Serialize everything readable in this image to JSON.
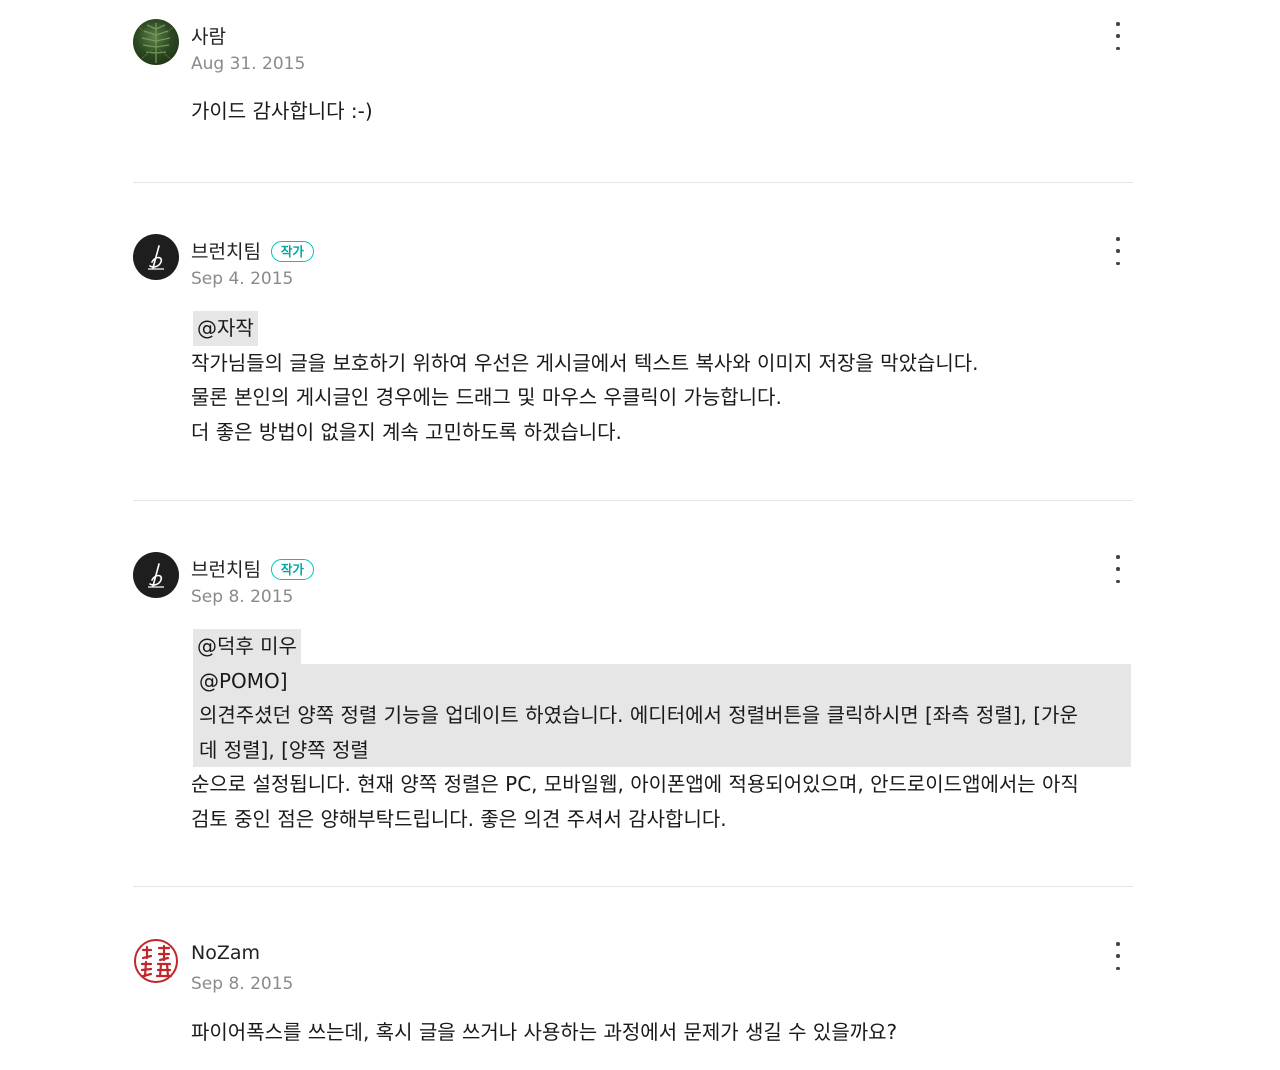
{
  "comments": [
    {
      "author": "사람",
      "date": "Aug 31. 2015",
      "lines": [
        "가이드 감사합니다 :-)"
      ]
    },
    {
      "author": "브런치팀",
      "badge": "작가",
      "date": "Sep 4. 2015",
      "mention": "@자작",
      "lines": [
        "작가님들의 글을 보호하기 위하여 우선은 게시글에서 텍스트 복사와 이미지 저장을 막았습니다.",
        "물론 본인의 게시글인 경우에는 드래그 및 마우스 우클릭이 가능합니다.",
        "더 좋은 방법이 없을지 계속 고민하도록 하겠습니다."
      ]
    },
    {
      "author": "브런치팀",
      "badge": "작가",
      "date": "Sep 8. 2015",
      "mention": "@덕후 미우",
      "quoted": [
        "@POMO]",
        "의견주셨던 양쪽 정렬 기능을 업데이트 하였습니다. 에디터에서 정렬버튼을 클릭하시면 [좌측 정렬], [가운",
        "데 정렬], [양쪽 정렬"
      ],
      "lines": [
        "순으로 설정됩니다. 현재 양쪽 정렬은 PC, 모바일웹, 아이폰앱에 적용되어있으며, 안드로이드앱에서는 아직",
        "검토 중인 점은 양해부탁드립니다. 좋은 의견 주셔서 감사합니다."
      ]
    },
    {
      "author": "NoZam",
      "date": "Sep 8. 2015",
      "lines": [
        "파이어폭스를 쓰는데, 혹시 글을 쓰거나 사용하는 과정에서 문제가 생길 수 있을까요?"
      ]
    }
  ]
}
